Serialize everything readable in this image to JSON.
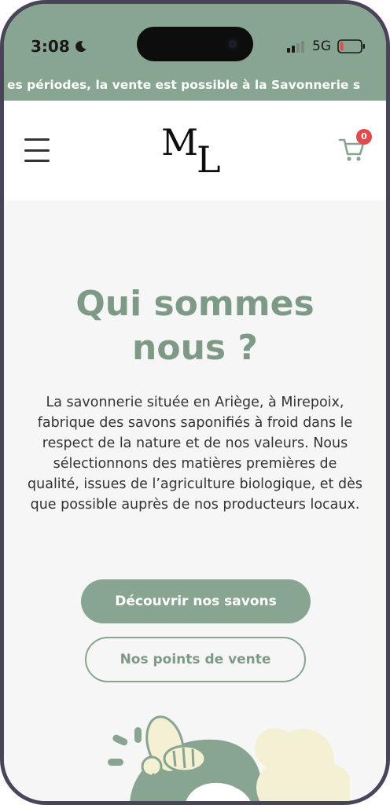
{
  "status_bar": {
    "time": "3:08",
    "network": "5G"
  },
  "marquee": {
    "text": "es périodes, la vente est possible à la Savonnerie s"
  },
  "header": {
    "logo_letter_1": "M",
    "logo_letter_2": "L",
    "cart_count": "0"
  },
  "main": {
    "title_line_1": "Qui sommes",
    "title_line_2": "nous ?",
    "description": "La savonnerie située en Ariège, à Mirepoix, fabrique des savons saponifiés à froid dans le respect de la nature et de nos valeurs. Nous sélectionnons des matières premières de qualité, issues de l’agriculture biologique, et dès que possible auprès de nos producteurs locaux.",
    "primary_button": "Découvrir nos savons",
    "secondary_button": "Nos points de vente"
  },
  "colors": {
    "brand_green": "#87a590",
    "title_green": "#7e9a86",
    "badge_red": "#e04b4b"
  },
  "icons": {
    "menu": "hamburger-icon",
    "cart": "cart-icon",
    "moon": "moon-icon",
    "signal": "signal-icon",
    "battery": "battery-icon"
  }
}
